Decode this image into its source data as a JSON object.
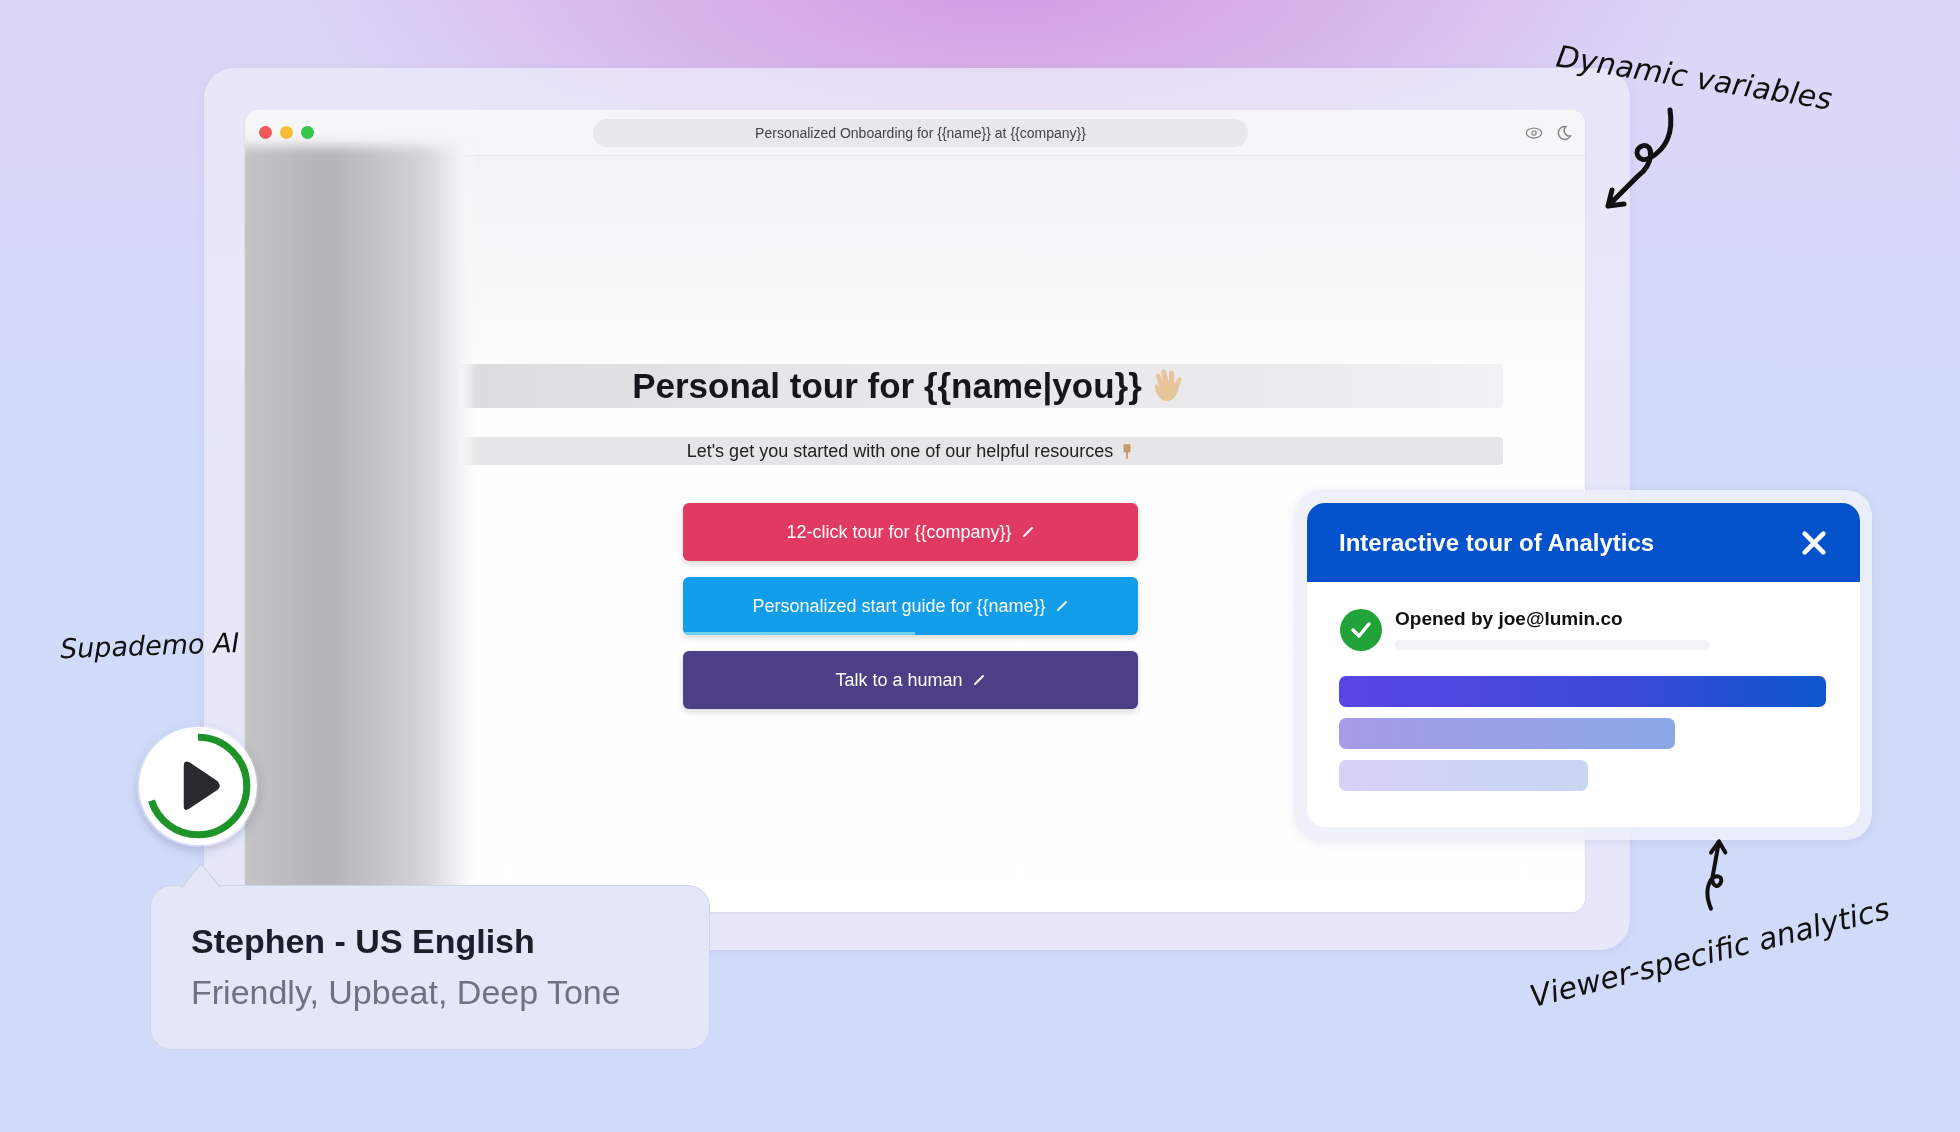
{
  "window": {
    "title": "Personalized Onboarding for {{name}} at {{company}}"
  },
  "page": {
    "heading": "Personal tour for {{name|you}}",
    "subtitle": "Let's get you started with one of our helpful resources",
    "buttons": [
      {
        "label": "12-click tour for {{company}}",
        "color": "#e13a62"
      },
      {
        "label": "Personalized start guide for {{name}}",
        "color": "#119de8",
        "level": 0.51
      },
      {
        "label": "Talk to a human",
        "color": "#4d3f86"
      }
    ]
  },
  "popup": {
    "title": "Interactive tour of Analytics",
    "viewer": "Opened by joe@lumin.co",
    "opened": true
  },
  "player": {
    "label": "Supademo AI",
    "level": 0.7,
    "voice": "Stephen - US English",
    "traits": "Friendly, Upbeat, Deep Tone"
  },
  "annotations": [
    {
      "text": "Dynamic variables",
      "kind": "top"
    },
    {
      "text": "Viewer-specific analytics",
      "kind": "bottom"
    }
  ]
}
